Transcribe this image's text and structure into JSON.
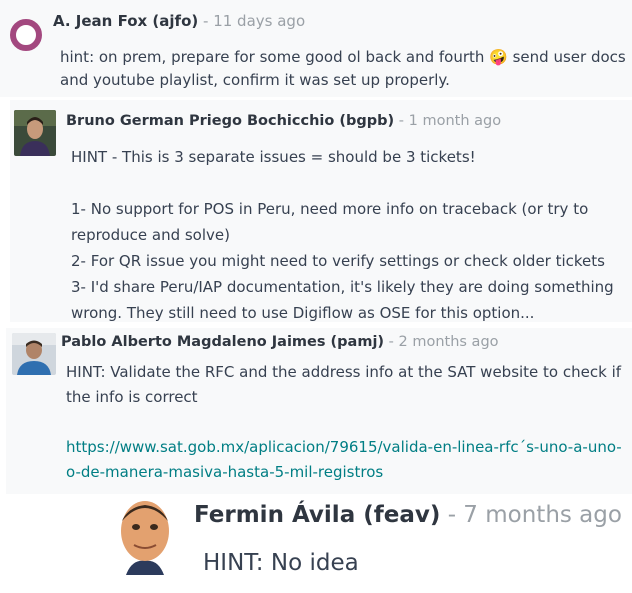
{
  "comments": [
    {
      "author": "A. Jean Fox (ajfo)",
      "time": "- 11 days ago",
      "avatar_icon": "user-ring-avatar",
      "avatar_color": "#a3487f",
      "lines": [
        "hint: on prem, prepare for some good ol back and fourth 🤪 send user docs and youtube playlist, confirm it was set up properly."
      ]
    },
    {
      "author": "Bruno German Priego Bochicchio (bgpb)",
      "time": "- 1 month ago",
      "avatar_icon": "user-photo-avatar",
      "lines": [
        "HINT - This is 3 separate issues = should be 3 tickets!",
        "",
        "1- No support for POS in Peru, need more info on traceback (or try to reproduce and solve)",
        "2- For QR issue you might need to verify settings or check older tickets",
        "3- I'd share Peru/IAP documentation, it's likely they are doing something wrong. They still need to use Digiflow as OSE for this option..."
      ]
    },
    {
      "author": "Pablo Alberto Magdaleno Jaimes (pamj)",
      "time": "- 2 months ago",
      "avatar_icon": "user-photo-avatar",
      "lines": [
        "HINT: Validate the RFC and the address info at the SAT website to check if the info is correct",
        ""
      ],
      "link": "https://www.sat.gob.mx/aplicacion/79615/valida-en-linea-rfc´s-uno-a-uno-o-de-manera-masiva-hasta-5-mil-registros"
    },
    {
      "author": "Fermin Ávila (feav)",
      "time": "- 7 months ago",
      "avatar_icon": "cartoon-face-avatar",
      "lines": [
        "HINT: No idea"
      ]
    }
  ],
  "colors": {
    "card_bg": "#f8f9fa",
    "link": "#017e84",
    "muted": "#9aa0a6"
  }
}
